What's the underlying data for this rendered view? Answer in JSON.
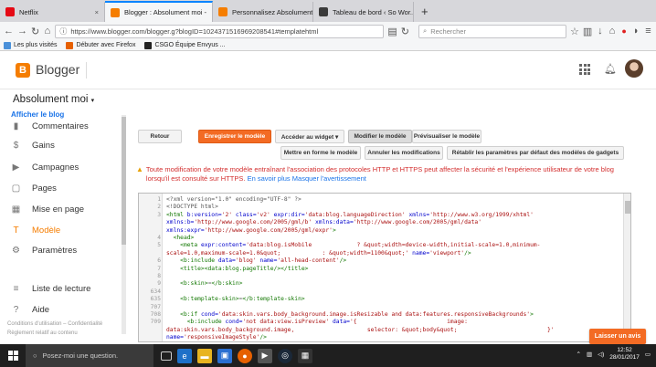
{
  "browser": {
    "tabs": [
      {
        "title": "Netflix",
        "color": "#e50914",
        "icon": "netflix-icon"
      },
      {
        "title": "Blogger : Absolument moi - ",
        "color": "#f57d00",
        "icon": "blogger-icon"
      },
      {
        "title": "Personnalisez Absolument Mo...",
        "color": "#f57d00",
        "icon": "blogger-icon"
      },
      {
        "title": "Tableau de bord ‹ So Wor...",
        "color": "#3a3a3a",
        "icon": "wordpress-icon"
      }
    ],
    "new_tab": "+",
    "url": "https://www.blogger.com/blogger.g?blogID=1024371516969208541#templatehtml",
    "search_placeholder": "Rechercher",
    "bookmarks": [
      {
        "label": "Les plus visités",
        "color": "#4a90d9"
      },
      {
        "label": "Débuter avec Firefox",
        "color": "#e66000"
      },
      {
        "label": "CSGO Équipe Envyus ...",
        "color": "#222222"
      }
    ]
  },
  "header": {
    "logo_letter": "B",
    "app_name": "Blogger"
  },
  "sidebar": {
    "blog_name": "Absolument moi",
    "view_blog": "Afficher le blog",
    "items": [
      {
        "label": "Commentaires",
        "icon": "comment-icon",
        "glyph": "▮"
      },
      {
        "label": "Gains",
        "icon": "dollar-icon",
        "glyph": "$"
      },
      {
        "label": "Campagnes",
        "icon": "megaphone-icon",
        "glyph": "▶"
      },
      {
        "label": "Pages",
        "icon": "page-icon",
        "glyph": "▢"
      },
      {
        "label": "Mise en page",
        "icon": "layout-icon",
        "glyph": "▦"
      },
      {
        "label": "Modèle",
        "icon": "template-icon",
        "glyph": "T"
      },
      {
        "label": "Paramètres",
        "icon": "settings-icon",
        "glyph": "⚙"
      },
      {
        "label": "Liste de lecture",
        "icon": "reading-list-icon",
        "glyph": "≡"
      },
      {
        "label": "Aide",
        "icon": "help-icon",
        "glyph": "?"
      }
    ],
    "footer": {
      "terms": "Conditions d'utilisation",
      "privacy": "Confidentialité",
      "content_policy": "Règlement relatif au contenu"
    }
  },
  "toolbar": {
    "back": "Retour",
    "save": "Enregistrer le modèle",
    "widget": "Accéder au widget ▾",
    "edit": "Modifier le modèle",
    "preview": "Prévisualiser le modèle",
    "format": "Mettre en forme le modèle",
    "undo": "Annuler les modifications",
    "reset": "Rétablir les paramètres par défaut des modèles de gadgets"
  },
  "warning": {
    "text": "Toute modification de votre modèle entraînant l'association des protocoles HTTP et HTTPS peut affecter la sécurité et l'expérience utilisateur de votre blog lorsqu'il est consulté sur HTTPS.",
    "link_more": "En savoir plus",
    "link_hide": "Masquer l'avertissement"
  },
  "editor": {
    "lines": [
      {
        "n": "1",
        "html": "<span class='cm'>&lt;?xml version=\"1.0\" encoding=\"UTF-8\" ?&gt;</span>"
      },
      {
        "n": "2",
        "html": "<span class='cm'>&lt;!DOCTYPE html&gt;</span>"
      },
      {
        "n": "3",
        "html": "<span class='tg'>&lt;html</span> <span class='at'>b:version=</span><span class='st'>'2'</span> <span class='at'>class=</span><span class='st'>'v2'</span> <span class='at'>expr:dir=</span><span class='st'>'data:blog.languageDirection'</span> <span class='at'>xmlns=</span><span class='st'>'http://www.w3.org/1999/xhtml'</span>"
      },
      {
        "n": "",
        "html": "<span class='at'>xmlns:b=</span><span class='st'>'http://www.google.com/2005/gml/b'</span> <span class='at'>xmlns:data=</span><span class='st'>'http://www.google.com/2005/gml/data'</span>"
      },
      {
        "n": "",
        "html": "<span class='at'>xmlns:expr=</span><span class='st'>'http://www.google.com/2005/gml/expr'</span><span class='tg'>&gt;</span>"
      },
      {
        "n": "4",
        "html": "  <span class='tg'>&lt;head&gt;</span>"
      },
      {
        "n": "5",
        "html": "    <span class='tg'>&lt;meta</span> <span class='at'>expr:content=</span><span class='st'>'data:blog.isMobile             ? &amp;quot;width=device-width,initial-scale=1.0,minimum-</span>"
      },
      {
        "n": "",
        "html": "<span class='st'>scale=1.0,maximum-scale=1.0&amp;quot;            : &amp;quot;width=1100&amp;quot;'</span> <span class='at'>name=</span><span class='st'>'viewport'</span><span class='tg'>/&gt;</span>"
      },
      {
        "n": "6",
        "html": "    <span class='tg'>&lt;b:include</span> <span class='at'>data=</span><span class='st'>'blog'</span> <span class='at'>name=</span><span class='st'>'all-head-content'</span><span class='tg'>/&gt;</span>"
      },
      {
        "n": "7",
        "html": "    <span class='tg'>&lt;title&gt;</span><span class='tg'>&lt;data:blog.pageTitle/&gt;</span><span class='tg'>&lt;/title&gt;</span>"
      },
      {
        "n": "8",
        "html": ""
      },
      {
        "n": "9",
        "html": "    <span class='tg'>&lt;b:skin&gt;</span>⋯<span class='tg'>&lt;/b:skin&gt;</span>",
        "fold": true
      },
      {
        "n": "634",
        "html": ""
      },
      {
        "n": "635",
        "html": "    <span class='tg'>&lt;b:template-skin&gt;</span>⋯<span class='tg'>&lt;/b:template-skin&gt;</span>",
        "fold": true
      },
      {
        "n": "707",
        "html": ""
      },
      {
        "n": "708",
        "html": "    <span class='tg'>&lt;b:if</span> <span class='at'>cond=</span><span class='st'>'data:skin.vars.body_background.image.isResizable and data:features.responsiveBackgrounds'</span><span class='tg'>&gt;</span>"
      },
      {
        "n": "709",
        "html": "      <span class='tg'>&lt;b:include</span> <span class='at'>cond=</span><span class='st'>'not data:view.isPreview'</span> <span class='at'>data=</span><span class='st'>'{                          image:</span>"
      },
      {
        "n": "",
        "html": "<span class='st'>data:skin.vars.body_background.image,                     selector: &amp;quot;body&amp;quot;                          }'</span>"
      },
      {
        "n": "",
        "html": "<span class='at'>name=</span><span class='st'>'responsiveImageStyle'</span><span class='tg'>/&gt;</span>"
      }
    ]
  },
  "feedback_button": "Laisser un avis",
  "taskbar": {
    "search_placeholder": "Posez-moi une question.",
    "time": "12:52",
    "date": "28/01/2017"
  }
}
